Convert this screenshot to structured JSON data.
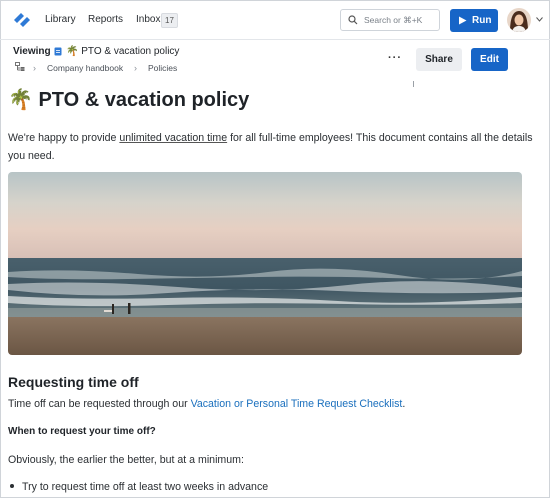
{
  "nav": {
    "items": [
      {
        "label": "Library"
      },
      {
        "label": "Reports"
      },
      {
        "label": "Inbox"
      }
    ],
    "inbox_count": "17",
    "search_placeholder": "Search or ⌘+K",
    "run_label": "Run"
  },
  "header": {
    "viewing_label": "Viewing",
    "doc_title": "🌴 PTO & vacation policy",
    "breadcrumbs": [
      "Company handbook",
      "Policies"
    ],
    "more_label": "···",
    "share_label": "Share",
    "edit_label": "Edit"
  },
  "doc": {
    "title": "🌴 PTO & vacation policy",
    "intro_before": " We're happy to provide ",
    "intro_link": "unlimited vacation time",
    "intro_after": " for all full-time employees! This document contains all the details you need.",
    "image_desc": "beach-photo",
    "section_heading": "Requesting time off",
    "section_text_before": "Time off can be requested through our ",
    "section_link": "Vacation or Personal Time Request Checklist",
    "section_text_after": ".",
    "subheading": "When to request your time off?",
    "body_text": "Obviously, the earlier the better, but at a minimum:",
    "bullets": [
      "Try to request time off at least two weeks in advance"
    ]
  },
  "colors": {
    "accent": "#1765c7",
    "link": "#1a6fbd",
    "logo": "#2f7ad6"
  },
  "icons": {
    "logo": "app-logo-icon",
    "search": "search-icon",
    "run": "play-icon",
    "doc": "document-icon",
    "breadcrumb": "hierarchy-icon",
    "chevron": "chevron-down-icon"
  }
}
